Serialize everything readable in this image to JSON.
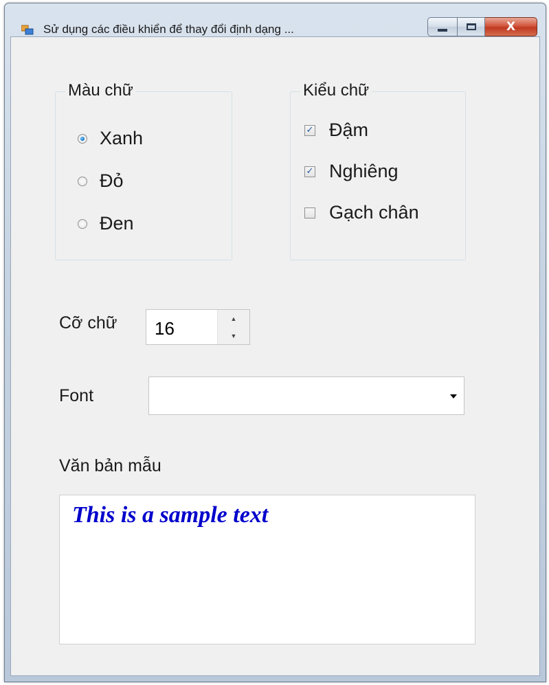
{
  "window": {
    "title": "Sử dụng các điều khiển để thay đổi định dạng ...",
    "icon": "app-form-icon",
    "buttons": {
      "minimize": "minimize-icon",
      "maximize": "maximize-icon",
      "close": "X"
    }
  },
  "color_group": {
    "title": "Màu chữ",
    "options": [
      {
        "label": "Xanh",
        "checked": true
      },
      {
        "label": "Đỏ",
        "checked": false
      },
      {
        "label": "Đen",
        "checked": false
      }
    ]
  },
  "style_group": {
    "title": "Kiểu chữ",
    "options": [
      {
        "label": "Đậm",
        "checked": true
      },
      {
        "label": "Nghiêng",
        "checked": true
      },
      {
        "label": "Gạch chân",
        "checked": false
      }
    ]
  },
  "size": {
    "label": "Cỡ chữ",
    "value": "16"
  },
  "font": {
    "label": "Font",
    "value": ""
  },
  "sample": {
    "label": "Văn bản mẫu",
    "text": "This is a sample text",
    "color": "#0000cc"
  },
  "colors": {
    "client_background": "#f0f0f0",
    "close_button": "#c7432a",
    "check_mark": "#21579e"
  }
}
